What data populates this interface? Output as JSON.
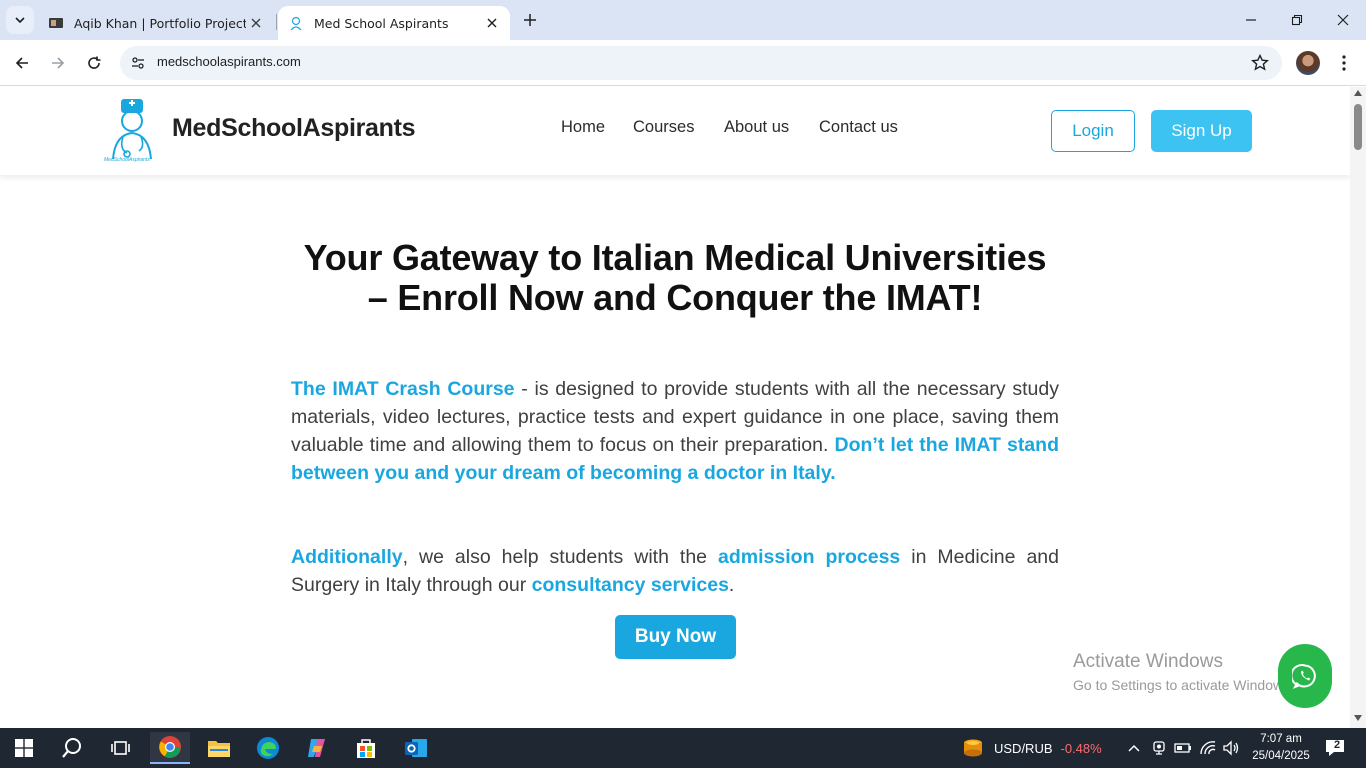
{
  "browser": {
    "tabs": [
      {
        "title": "Aqib Khan | Portfolio Projects",
        "active": false
      },
      {
        "title": "Med School Aspirants",
        "active": true
      }
    ],
    "url": "medschoolaspirants.com"
  },
  "site": {
    "brand": "MedSchoolAspirants",
    "logo_caption": "MedSchoolAspirants",
    "nav": [
      "Home",
      "Courses",
      "About us",
      "Contact us"
    ],
    "login": "Login",
    "signup": "Sign Up",
    "hero_title": "Your Gateway to Italian Medical Universities – Enroll Now and Conquer the IMAT!",
    "p1": {
      "lead": "The IMAT Crash Course",
      "text": " - is designed to provide students with all the necessary study materials, video lectures, practice tests and expert guidance in one place, saving them valuable time and allowing them to focus on their preparation. ",
      "emphasis": "Don’t let the IMAT stand between you and your dream of becoming a doctor in Italy."
    },
    "p2": {
      "lead": "Additionally",
      "text1": ", we also help students with the ",
      "hl1": "admission process",
      "text2": " in Medicine and Surgery in Italy through our ",
      "hl2": "consultancy services",
      "text3": "."
    },
    "buy_now": "Buy Now",
    "watermark": {
      "line1": "Activate Windows",
      "line2": "Go to Settings to activate Windows."
    },
    "colors": {
      "accent": "#1aa7df",
      "signup": "#3cc3f2",
      "whatsapp": "#28b74b"
    }
  },
  "taskbar": {
    "ticker_pair": "USD/RUB",
    "ticker_change": "-0.48%",
    "time": "7:07 am",
    "date": "25/04/2025",
    "notifications": "2",
    "apps": [
      "windows-start-icon",
      "search-icon",
      "task-view-icon",
      "chrome-icon",
      "file-explorer-icon",
      "edge-icon",
      "copilot-icon",
      "store-icon",
      "outlook-icon"
    ]
  }
}
